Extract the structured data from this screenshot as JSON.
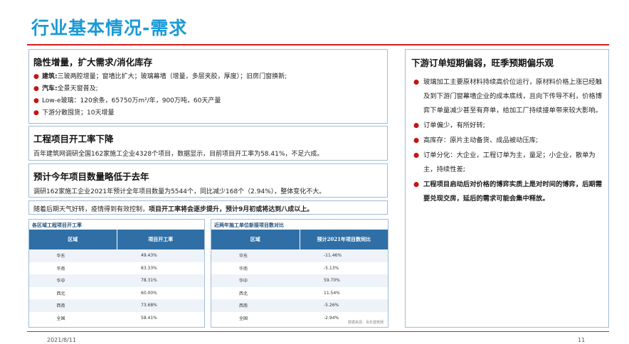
{
  "page": {
    "title": "行业基本情况-需求",
    "date": "2021/8/11",
    "page_number": "11"
  },
  "left": {
    "box1": {
      "heading": "隐性增量，扩大需求/消化库存",
      "items": [
        {
          "label": "建筑:",
          "text": "三玻两腔增量；窗墙比扩大；玻璃幕墙（增量，多层夹胶，厚度）；旧房门窗换新;"
        },
        {
          "label": "汽车:",
          "text": "全景天窗普及;"
        },
        {
          "label": "",
          "text": "Low-e玻璃：120余条，65750万m²/年，900万吨，60天产量"
        },
        {
          "label": "",
          "text": "下游分散囤货；10天增量"
        }
      ]
    },
    "box2": {
      "heading": "工程项目开工率下降",
      "text": "百年建筑网调研全国162家施工企业4328个项目，数据显示，目前项目开工率为58.41%，不足六成。"
    },
    "box3": {
      "heading": "预计今年项目数量略低于去年",
      "text": "调研162家施工企业2021年预计全年项目数量为5544个，同比减少168个（2.94%），整体变化不大。"
    },
    "box4": {
      "text_plain": "随着后期天气好转，疫情得到有效控制，",
      "text_bold": "项目开工率将会逐步提升，预计9月初或将达到八成以上。"
    }
  },
  "table1": {
    "title": "各区域工程项目开工率",
    "headers": [
      "区域",
      "项目开工率"
    ],
    "rows": [
      [
        "华东",
        "49.43%"
      ],
      [
        "华南",
        "83.33%"
      ],
      [
        "华中",
        "78.31%"
      ],
      [
        "西北",
        "60.00%"
      ],
      [
        "西南",
        "73.68%"
      ],
      [
        "全国",
        "58.41%"
      ]
    ],
    "source": ""
  },
  "table2": {
    "title": "近两年施工单位新接项目数对比",
    "headers": [
      "区域",
      "预计2021年项目数同比"
    ],
    "rows": [
      [
        "华东",
        "-11.46%"
      ],
      [
        "华南",
        "-5.13%"
      ],
      [
        "华中",
        "59.70%"
      ],
      [
        "西北",
        "11.54%"
      ],
      [
        "西南",
        "-5.26%"
      ],
      [
        "全国",
        "-2.94%"
      ]
    ],
    "source": "数据来源：百年建筑网"
  },
  "right": {
    "heading": "下游订单短期偏弱，旺季预期偏乐观",
    "items": [
      {
        "text": "玻璃加工主要原材料持续高价位运行，原材料价格上涨已经触及到下游门窗幕墙企业的成本底线，且向下传导不利，价格博弈下单量减少甚至有弃单，给加工厂持续接单带来较大影响。",
        "bold": false
      },
      {
        "text": "订单偏少，有所好转;",
        "bold": false
      },
      {
        "text": "高库存：原片主动备货、成品被动压库;",
        "bold": false
      },
      {
        "text": "订单分化：大企业，工程订单为主，量足；小企业，散单为主，持续性差;",
        "bold": false
      },
      {
        "text": "工程项目启动后对价格的博弈实质上是对时间的博弈，后期需要兑现交房，延后的需求可能会集中释放。",
        "bold": true
      }
    ]
  },
  "colors": {
    "title_blue": "#1a9ad6",
    "accent_red": "#d81e1e",
    "table_header": "#2f6fa6",
    "box_border": "#9fbcd6"
  }
}
